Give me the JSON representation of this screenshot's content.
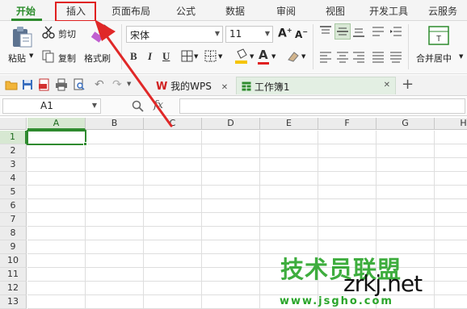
{
  "menu": {
    "tabs": [
      "开始",
      "插入",
      "页面布局",
      "公式",
      "数据",
      "审阅",
      "视图",
      "开发工具",
      "云服务"
    ],
    "active_index": 0,
    "highlighted_index": 1,
    "accent_color": "#2e8b2e",
    "highlight_color": "#e02020"
  },
  "ribbon": {
    "paste_label": "粘贴",
    "cut_label": "剪切",
    "copy_label": "复制",
    "format_painter_label": "格式刷",
    "font_name": "宋体",
    "font_size": "11",
    "bold_label": "B",
    "italic_label": "I",
    "underline_label": "U",
    "merge_center_label": "合并居中"
  },
  "quick_access": {
    "doc_tabs": [
      {
        "label": "我的WPS",
        "active": false
      },
      {
        "label": "工作簿1",
        "active": true
      }
    ],
    "new_tab_label": "+"
  },
  "formula_bar": {
    "cell_reference": "A1",
    "fx_label": "fx",
    "content": ""
  },
  "sheet": {
    "columns": [
      "A",
      "B",
      "C",
      "D",
      "E",
      "F",
      "G",
      "H"
    ],
    "rows": [
      "1",
      "2",
      "3",
      "4",
      "5",
      "6",
      "7",
      "8",
      "9",
      "10",
      "11",
      "12",
      "13"
    ],
    "active_cell": "A1"
  },
  "watermark": {
    "logo_text": "技术员联盟",
    "domain_text": "zrkj.net",
    "url_text": "www.jsgho.com"
  }
}
